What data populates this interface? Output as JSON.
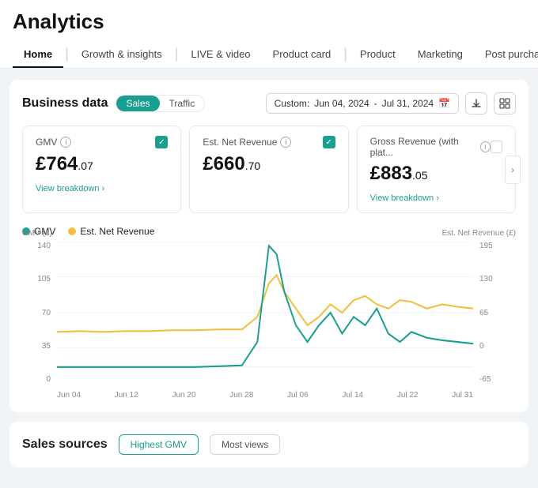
{
  "header": {
    "title": "Analytics",
    "nav": [
      {
        "label": "Home",
        "active": true
      },
      {
        "label": "Growth & insights",
        "active": false
      },
      {
        "label": "LIVE & video",
        "active": false
      },
      {
        "label": "Product card",
        "active": false
      },
      {
        "label": "Product",
        "active": false
      },
      {
        "label": "Marketing",
        "active": false
      },
      {
        "label": "Post purchase",
        "active": false
      }
    ]
  },
  "businessData": {
    "title": "Business data",
    "tabs": [
      {
        "label": "Sales",
        "active": true
      },
      {
        "label": "Traffic",
        "active": false
      }
    ],
    "dateRange": {
      "label": "Custom:",
      "from": "Jun 04, 2024",
      "to": "Jul 31, 2024"
    },
    "metrics": [
      {
        "label": "GMV",
        "checked": true,
        "value": "£764",
        "decimal": ".07",
        "hasBreakdown": true
      },
      {
        "label": "Est. Net Revenue",
        "checked": true,
        "value": "£660",
        "decimal": ".70",
        "hasBreakdown": false
      },
      {
        "label": "Gross Revenue (with plat...",
        "checked": false,
        "value": "£883",
        "decimal": ".05",
        "hasBreakdown": true
      }
    ],
    "chart": {
      "yLeftLabel": "GMV (£)",
      "yRightLabel": "Est. Net Revenue (£)",
      "yLeftValues": [
        "140",
        "105",
        "70",
        "35",
        "0"
      ],
      "yRightValues": [
        "195",
        "130",
        "65",
        "0",
        "-65"
      ],
      "xLabels": [
        "Jun 04",
        "Jun 12",
        "Jun 20",
        "Jun 28",
        "Jul 06",
        "Jul 14",
        "Jul 22",
        "Jul 31"
      ],
      "legend": [
        {
          "label": "GMV",
          "color": "#1a9e8f"
        },
        {
          "label": "Est. Net Revenue",
          "color": "#f0c040"
        }
      ]
    }
  },
  "salesSources": {
    "title": "Sales sources",
    "tabs": [
      {
        "label": "Highest GMV",
        "active": true
      },
      {
        "label": "Most views",
        "active": false
      }
    ]
  }
}
